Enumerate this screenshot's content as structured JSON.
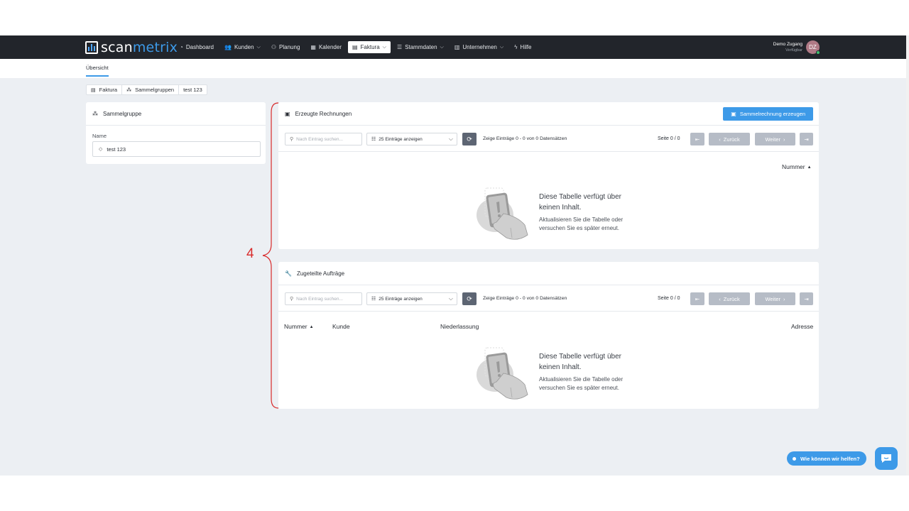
{
  "brand": {
    "name_part1": "scan",
    "name_part2": "metrix"
  },
  "nav": {
    "items": [
      {
        "label": "Dashboard",
        "icon": "dashboard-icon"
      },
      {
        "label": "Kunden",
        "icon": "users-icon",
        "dropdown": true
      },
      {
        "label": "Planung",
        "icon": "sitemap-icon"
      },
      {
        "label": "Kalender",
        "icon": "calendar-icon"
      },
      {
        "label": "Faktura",
        "icon": "money-icon",
        "dropdown": true,
        "active": true
      },
      {
        "label": "Stammdaten",
        "icon": "database-icon",
        "dropdown": true
      },
      {
        "label": "Unternehmen",
        "icon": "building-icon",
        "dropdown": true
      },
      {
        "label": "Hilfe",
        "icon": "help-icon"
      }
    ]
  },
  "user": {
    "name": "Demo Zugang",
    "status": "Verfügbar",
    "initials": "DZ"
  },
  "subnav": {
    "tab": "Übersicht"
  },
  "breadcrumb": {
    "items": [
      "Faktura",
      "Sammelgruppen",
      "test 123"
    ]
  },
  "left_card": {
    "title": "Sammelgruppe",
    "field_label": "Name",
    "field_value": "test 123"
  },
  "invoices": {
    "title": "Erzeugte Rechnungen",
    "create_button": "Sammelrechnung erzeugen",
    "search_placeholder": "Nach Eintrag suchen...",
    "page_size": "25 Einträge anzeigen",
    "info": "Zeige Einträge 0 - 0 von 0 Datensätzen",
    "page": "Seite 0 / 0",
    "prev": "Zurück",
    "next": "Weiter",
    "columns": [
      "Nummer"
    ],
    "empty_title": "Diese Tabelle verfügt über keinen Inhalt.",
    "empty_text": "Aktualisieren Sie die Tabelle oder versuchen Sie es später erneut."
  },
  "orders": {
    "title": "Zugeteilte Aufträge",
    "search_placeholder": "Nach Eintrag suchen...",
    "page_size": "25 Einträge anzeigen",
    "info": "Zeige Einträge 0 - 0 von 0 Datensätzen",
    "page": "Seite 0 / 0",
    "prev": "Zurück",
    "next": "Weiter",
    "columns": [
      "Nummer",
      "Kunde",
      "Niederlassung",
      "Adresse"
    ],
    "empty_title": "Diese Tabelle verfügt über keinen Inhalt.",
    "empty_text": "Aktualisieren Sie die Tabelle oder versuchen Sie es später erneut."
  },
  "annotation": {
    "number": "4",
    "color": "#d92b2b"
  },
  "help": {
    "label": "Wie können wir helfen?"
  },
  "colors": {
    "accent": "#3d9ae8",
    "navbar": "#22252b",
    "background": "#eceff3"
  }
}
